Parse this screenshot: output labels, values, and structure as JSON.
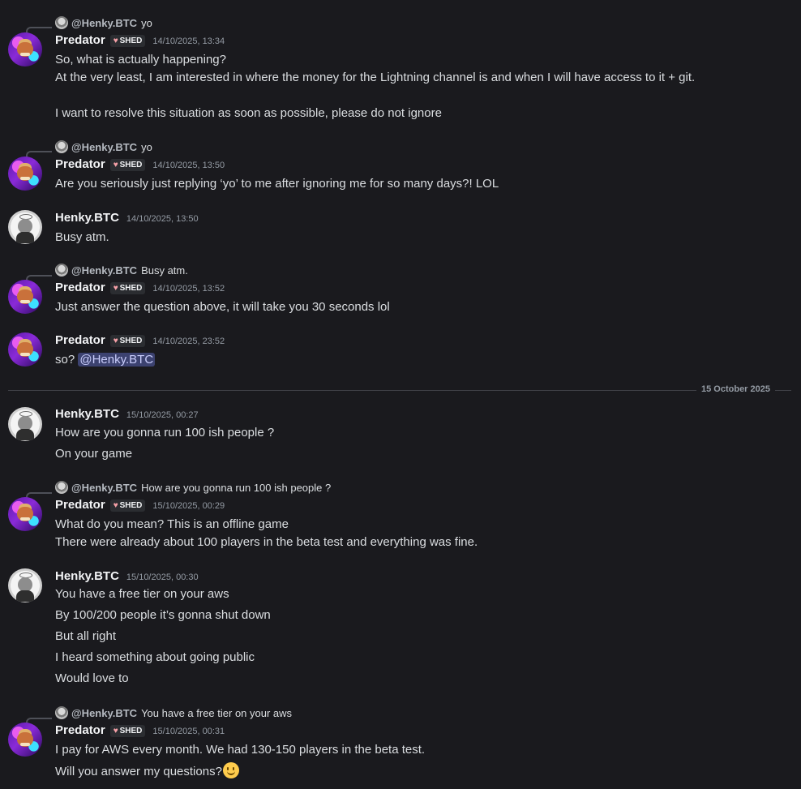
{
  "messages": [
    {
      "reply": {
        "name": "@Henky.BTC",
        "text": "yo"
      },
      "author": "Predator",
      "tag": "SHED",
      "time": "14/10/2025, 13:34",
      "lines": [
        "So, what is actually happening?",
        "At the very least, I am interested in where the money for the Lightning channel is and when I will have access to it + git.",
        "",
        "I want to resolve this situation as soon as possible, please do not ignore"
      ]
    },
    {
      "reply": {
        "name": "@Henky.BTC",
        "text": "yo"
      },
      "author": "Predator",
      "tag": "SHED",
      "time": "14/10/2025, 13:50",
      "lines": [
        "Are you seriously just replying ‘yo’ to me after ignoring me for so many days?! LOL"
      ]
    },
    {
      "author": "Henky.BTC",
      "time": "14/10/2025, 13:50",
      "lines": [
        "Busy atm."
      ]
    },
    {
      "reply": {
        "name": "@Henky.BTC",
        "text": "Busy atm."
      },
      "author": "Predator",
      "tag": "SHED",
      "time": "14/10/2025, 13:52",
      "lines": [
        "Just answer the question above, it will take you 30 seconds lol"
      ]
    },
    {
      "author": "Predator",
      "tag": "SHED",
      "time": "14/10/2025, 23:52",
      "lines": [
        "so?"
      ],
      "mention": "@Henky.BTC"
    },
    {
      "author": "Henky.BTC",
      "time": "15/10/2025, 00:27",
      "lines": [
        "How are you gonna run 100 ish people ?",
        "On your game"
      ]
    },
    {
      "reply": {
        "name": "@Henky.BTC",
        "text": "How are you gonna run 100 ish people ?"
      },
      "author": "Predator",
      "tag": "SHED",
      "time": "15/10/2025, 00:29",
      "lines": [
        "What do you mean? This is an offline game",
        "There were already about 100 players in the beta test and everything was fine."
      ]
    },
    {
      "author": "Henky.BTC",
      "time": "15/10/2025, 00:30",
      "lines": [
        "You have a free tier on your aws",
        "By 100/200 people it’s gonna shut down",
        "But all right",
        "I heard something about going public",
        "Would love to"
      ]
    },
    {
      "reply": {
        "name": "@Henky.BTC",
        "text": "You have a free tier on your aws"
      },
      "author": "Predator",
      "tag": "SHED",
      "time": "15/10/2025, 00:31",
      "lines": [
        "I pay for AWS every month. We had 130-150 players in the beta test.",
        "Will you answer my questions?"
      ],
      "emoji": "slightly-smiling-face-icon"
    }
  ],
  "date_divider": "15 October 2025"
}
